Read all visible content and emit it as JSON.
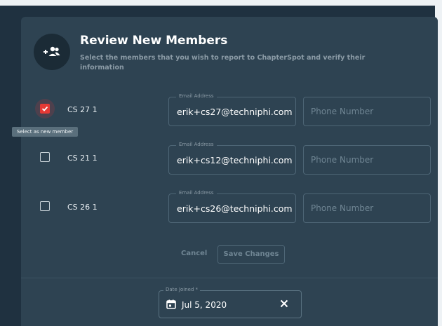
{
  "dialog": {
    "title": "Review New Members",
    "subtitle": "Select the members that you wish to report to ChapterSpot and verify their information"
  },
  "members": [
    {
      "name": "CS 27 1",
      "selected": true,
      "email_label": "Email Address",
      "email": "erik+cs27@techniphi.com",
      "phone_placeholder": "Phone Number"
    },
    {
      "name": "CS 21 1",
      "selected": false,
      "email_label": "Email Address",
      "email": "erik+cs12@techniphi.com",
      "phone_placeholder": "Phone Number"
    },
    {
      "name": "CS 26 1",
      "selected": false,
      "email_label": "Email Address",
      "email": "erik+cs26@techniphi.com",
      "phone_placeholder": "Phone Number"
    }
  ],
  "tooltip": "Select as new member",
  "actions": {
    "cancel": "Cancel",
    "save": "Save Changes"
  },
  "date_joined": {
    "label": "Date Joined *",
    "value": "Jul 5, 2020"
  },
  "icons": {
    "avatar": "add-group-icon",
    "calendar": "calendar-icon",
    "clear": "close-icon",
    "check": "check-icon"
  },
  "colors": {
    "accent": "#e53935",
    "card": "#2e4352",
    "background": "#1f3140"
  }
}
